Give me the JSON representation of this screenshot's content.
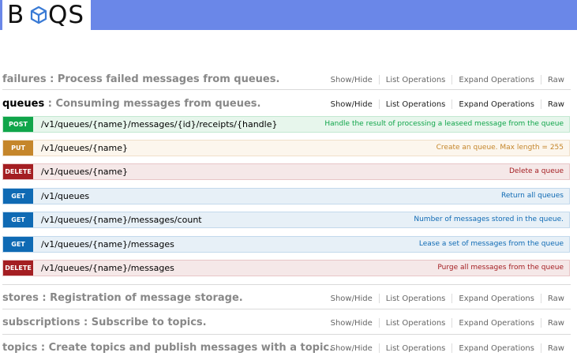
{
  "logo": {
    "left": "B",
    "right": "QS",
    "icon": "cube-icon"
  },
  "links": {
    "show_hide": "Show/Hide",
    "list_ops": "List Operations",
    "expand_ops": "Expand Operations",
    "raw": "Raw"
  },
  "resources": [
    {
      "name": "failures",
      "desc": " : Process failed messages from queues."
    },
    {
      "name": "queues",
      "desc": " : Consuming messages from queues."
    },
    {
      "name": "stores",
      "desc": " : Registration of message storage."
    },
    {
      "name": "subscriptions",
      "desc": " : Subscribe to topics."
    },
    {
      "name": "topics",
      "desc": " : Create topics and publish messages with a topic."
    }
  ],
  "operations": [
    {
      "method": "POST",
      "path": "/v1/queues/{name}/messages/{id}/receipts/{handle}",
      "summary": "Handle the result of processing a leaseed message from the queue"
    },
    {
      "method": "PUT",
      "path": "/v1/queues/{name}",
      "summary": "Create an queue. Max length = 255"
    },
    {
      "method": "DELETE",
      "path": "/v1/queues/{name}",
      "summary": "Delete a queue"
    },
    {
      "method": "GET",
      "path": "/v1/queues",
      "summary": "Return all queues"
    },
    {
      "method": "GET",
      "path": "/v1/queues/{name}/messages/count",
      "summary": "Number of messages stored in the queue."
    },
    {
      "method": "GET",
      "path": "/v1/queues/{name}/messages",
      "summary": "Lease a set of messages from the queue"
    },
    {
      "method": "DELETE",
      "path": "/v1/queues/{name}/messages",
      "summary": "Purge all messages from the queue"
    }
  ],
  "colors": {
    "header": "#6a87e8",
    "post": "#10a54a",
    "put": "#c5862b",
    "delete": "#a41e22",
    "get": "#0f6ab4"
  }
}
